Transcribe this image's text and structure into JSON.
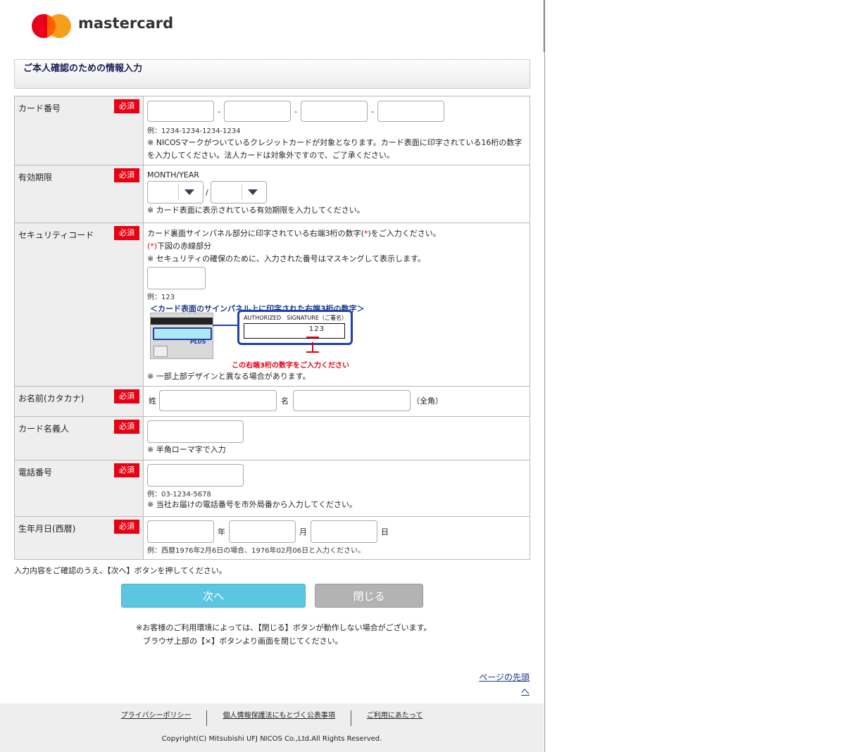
{
  "brand": {
    "name": "mastercard"
  },
  "title": "ご本人確認のための情報入力",
  "required_label": "必須",
  "card_number": {
    "label": "カード番号",
    "separator": "-",
    "example": "例：1234-1234-1234-1234",
    "note": "※ NICOSマークがついているクレジットカードが対象となります。カード表面に印字されている16桁の数字を入力してください。法人カードは対象外ですので、ご了承ください。"
  },
  "expiry": {
    "label": "有効期限",
    "format": "MONTH/YEAR",
    "separator": "/",
    "month_value": "",
    "year_value": "",
    "note": "※ カード表面に表示されている有効期限を入力してください。"
  },
  "security_code": {
    "label": "セキュリティコード",
    "line1_pre": "カード裏面サインパネル部分に印字されている右端3桁の数字(",
    "line1_mark": "*",
    "line1_post": ")をご入力ください。",
    "line2_mark": "(*)",
    "line2_post": "下図の赤線部分",
    "line3": "※ セキュリティの確保のために、入力された番号はマスキングして表示します。",
    "example": "例：123",
    "illus_caption": "＜カード表面のサインパネル上に印字された右端3桁の数字＞",
    "illus_auth": "AUTHORIZED　SIGNATURE（ご署名）",
    "illus_number": "123",
    "illus_plus": "PLUS",
    "illus_red": "この右端3桁の数字をご入力ください",
    "note": "※ 一部上部デザインと異なる場合があります。"
  },
  "name": {
    "label": "お名前(カタカナ)",
    "family": "姓",
    "given": "名",
    "suffix": "（全角）"
  },
  "holder": {
    "label": "カード名義人",
    "note": "※ 半角ローマ字で入力"
  },
  "phone": {
    "label": "電話番号",
    "example": "例：03-1234-5678",
    "note": "※ 当社お届けの電話番号を市外局番から入力してください。"
  },
  "birth": {
    "label": "生年月日(西暦)",
    "year": "年",
    "month": "月",
    "day": "日",
    "example": "例：西暦1976年2月6日の場合、1976年02月06日と入力ください。"
  },
  "instruction": "入力内容をご確認のうえ、【次へ】ボタンを押してください。",
  "buttons": {
    "next": "次へ",
    "close": "閉じる"
  },
  "notice": {
    "line1": "※お客様のご利用環境によっては、【閉じる】ボタンが動作しない場合がございます。",
    "line2": "ブラウザ上部の【×】ボタンより画面を閉じてください。"
  },
  "page_top": "ページの先頭へ",
  "footer": {
    "links": [
      "プライバシーポリシー",
      "個人情報保護法にもとづく公表事項",
      "ご利用にあたって"
    ],
    "copyright": "Copyright(C) Mitsubishi UFJ NICOS Co.,Ltd.All Rights Reserved."
  },
  "colors": {
    "required": "#e60012",
    "next_button": "#5bc6e1",
    "close_button": "#b3b3b3",
    "link": "#1a3a8a"
  }
}
